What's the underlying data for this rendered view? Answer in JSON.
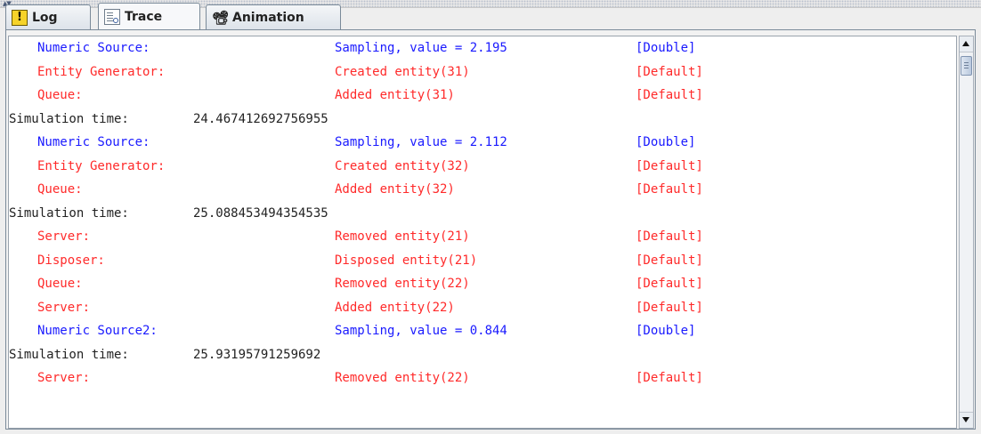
{
  "tabs": [
    {
      "label": "Log",
      "icon": "log-warning-icon"
    },
    {
      "label": "Trace",
      "icon": "trace-document-icon",
      "active": true
    },
    {
      "label": "Animation",
      "icon": "animation-projector-icon"
    }
  ],
  "colors": {
    "source": "#1a1aff",
    "event": "#ff2a2a",
    "time": "#222222"
  },
  "trace": {
    "rows": [
      {
        "kind": "entry",
        "color": "blue",
        "source": "Numeric Source:",
        "event": "Sampling, value = 2.195",
        "type": "[Double]"
      },
      {
        "kind": "entry",
        "color": "red",
        "source": "Entity Generator:",
        "event": "Created entity(31)",
        "type": "[Default]"
      },
      {
        "kind": "entry",
        "color": "red",
        "source": "Queue:",
        "event": "Added entity(31)",
        "type": "[Default]"
      },
      {
        "kind": "time",
        "label": "Simulation time:",
        "value": "24.467412692756955"
      },
      {
        "kind": "entry",
        "color": "blue",
        "source": "Numeric Source:",
        "event": "Sampling, value = 2.112",
        "type": "[Double]"
      },
      {
        "kind": "entry",
        "color": "red",
        "source": "Entity Generator:",
        "event": "Created entity(32)",
        "type": "[Default]"
      },
      {
        "kind": "entry",
        "color": "red",
        "source": "Queue:",
        "event": "Added entity(32)",
        "type": "[Default]"
      },
      {
        "kind": "time",
        "label": "Simulation time:",
        "value": "25.088453494354535"
      },
      {
        "kind": "entry",
        "color": "red",
        "source": "Server:",
        "event": "Removed entity(21)",
        "type": "[Default]"
      },
      {
        "kind": "entry",
        "color": "red",
        "source": "Disposer:",
        "event": "Disposed entity(21)",
        "type": "[Default]"
      },
      {
        "kind": "entry",
        "color": "red",
        "source": "Queue:",
        "event": "Removed entity(22)",
        "type": "[Default]"
      },
      {
        "kind": "entry",
        "color": "red",
        "source": "Server:",
        "event": "Added entity(22)",
        "type": "[Default]"
      },
      {
        "kind": "entry",
        "color": "blue",
        "source": "Numeric Source2:",
        "event": "Sampling, value = 0.844",
        "type": "[Double]"
      },
      {
        "kind": "time",
        "label": "Simulation time:",
        "value": "25.93195791259692"
      },
      {
        "kind": "entry",
        "color": "red",
        "source": "Server:",
        "event": "Removed entity(22)",
        "type": "[Default]"
      }
    ]
  }
}
